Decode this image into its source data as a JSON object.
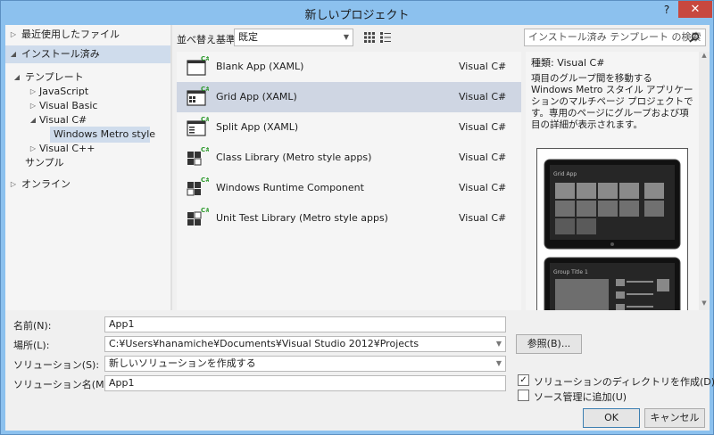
{
  "window": {
    "title": "新しいプロジェクト",
    "help_label": "?",
    "close_label": "✕"
  },
  "tree": {
    "recent": "最近使用したファイル",
    "installed": "インストール済み",
    "templates": "テンプレート",
    "javascript": "JavaScript",
    "visual_basic": "Visual Basic",
    "visual_csharp": "Visual C#",
    "metro_style": "Windows Metro style",
    "visual_cpp": "Visual C++",
    "samples": "サンプル",
    "online": "オンライン"
  },
  "toolbar": {
    "sort_label": "並べ替え基準:",
    "sort_value": "既定"
  },
  "search": {
    "placeholder": "インストール済み テンプレート の検索"
  },
  "templates": [
    {
      "name": "Blank App (XAML)",
      "lang": "Visual C#"
    },
    {
      "name": "Grid App (XAML)",
      "lang": "Visual C#"
    },
    {
      "name": "Split App (XAML)",
      "lang": "Visual C#"
    },
    {
      "name": "Class Library (Metro style apps)",
      "lang": "Visual C#"
    },
    {
      "name": "Windows Runtime Component",
      "lang": "Visual C#"
    },
    {
      "name": "Unit Test Library (Metro style apps)",
      "lang": "Visual C#"
    }
  ],
  "details": {
    "type_label": "種類:",
    "type_value": "Visual C#",
    "description": "項目のグループ間を移動する Windows Metro スタイル アプリケーションのマルチページ プロジェクトです。専用のページにグループおよび項目の詳細が表示されます。",
    "preview_title_1": "Grid App",
    "preview_title_2": "Group Title 1"
  },
  "form": {
    "name_label": "名前(N):",
    "name_value": "App1",
    "location_label": "場所(L):",
    "location_value": "C:¥Users¥hanamiche¥Documents¥Visual Studio 2012¥Projects",
    "browse_label": "参照(B)...",
    "solution_label": "ソリューション(S):",
    "solution_value": "新しいソリューションを作成する",
    "solution_name_label": "ソリューション名(M):",
    "solution_name_value": "App1",
    "create_dir_label": "ソリューションのディレクトリを作成(D)",
    "source_control_label": "ソース管理に追加(U)",
    "ok_label": "OK",
    "cancel_label": "キャンセル",
    "check_mark": "✓"
  },
  "colors": {
    "titlebar": "#8cc1ee",
    "close": "#c7483f",
    "selection": "#cfdcec",
    "accent_green": "#2d9a2d"
  }
}
